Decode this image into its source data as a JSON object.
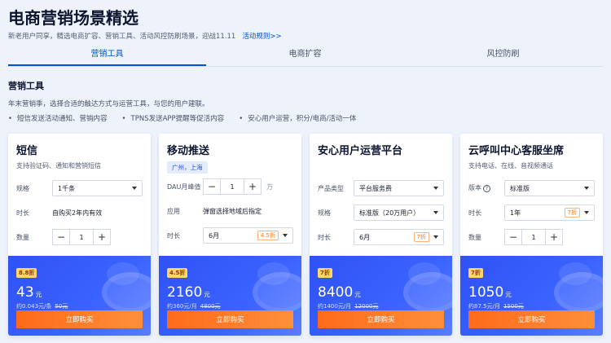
{
  "header": {
    "title": "电商营销场景精选",
    "subtitle": "新老用户同享，精选电商扩容、营销工具、活动风控防刷场景，迎战11.11",
    "rules_link": "活动规则>>"
  },
  "tabs": [
    {
      "label": "营销工具",
      "active": true
    },
    {
      "label": "电商扩容",
      "active": false
    },
    {
      "label": "风控防刷",
      "active": false
    }
  ],
  "section": {
    "title": "营销工具",
    "desc": "年末营销季，选择合适的触达方式与运营工具，与您的用户建联。",
    "bullets": [
      "短信发送活动通知、营销内容",
      "TPNS发送APP提醒等促活内容",
      "安心用户运营，积分/电商/活动一体"
    ]
  },
  "cards": [
    {
      "title": "短信",
      "desc": "支持验证码、通知和营销短信",
      "rows": {
        "spec_label": "规格",
        "spec_value": "1千条",
        "duration_label": "时长",
        "duration_value": "自购买2年内有效",
        "qty_label": "数量",
        "qty_value": "1"
      },
      "badge": "8.8折",
      "price": "43",
      "unit": "元",
      "price_note": "约0.043元/条",
      "original": "50元",
      "buy": "立即购买"
    },
    {
      "title": "移动推送",
      "region": "广州，上海",
      "rows": {
        "dau_label": "DAU月峰值",
        "dau_value": "1",
        "dau_unit": "万",
        "app_label": "应用",
        "app_value": "弹窗选择地域后指定",
        "duration_label": "时长",
        "duration_value": "6月",
        "duration_discount": "4.5折"
      },
      "badge": "4.5折",
      "price": "2160",
      "unit": "元",
      "price_note": "约360元/月",
      "original": "4800元",
      "buy": "立即购买"
    },
    {
      "title": "安心用户运营平台",
      "rows": {
        "type_label": "产品类型",
        "type_value": "平台服务费",
        "spec_label": "规格",
        "spec_value": "标准版（20万用户）",
        "duration_label": "时长",
        "duration_value": "6月",
        "duration_discount": "7折"
      },
      "badge": "7折",
      "price": "8400",
      "unit": "元",
      "price_note": "约1400元/月",
      "original": "12000元",
      "buy": "立即购买"
    },
    {
      "title": "云呼叫中心客服坐席",
      "desc": "支持电话、在线、音视频通话",
      "rows": {
        "version_label": "版本",
        "version_value": "标准版",
        "duration_label": "时长",
        "duration_value": "1年",
        "duration_discount": "7折",
        "qty_label": "数量",
        "qty_value": "1"
      },
      "badge": "7折",
      "price": "1050",
      "unit": "元",
      "price_note": "约87.5元/月",
      "original": "1500元",
      "buy": "立即购买"
    }
  ],
  "icons": {
    "help": "?",
    "minus": "−",
    "plus": "+"
  },
  "colors": {
    "primary": "#0052d9",
    "buy": "#ff7a1a",
    "card_bottom": "#3a63ff",
    "badge": "#ffd66b"
  }
}
